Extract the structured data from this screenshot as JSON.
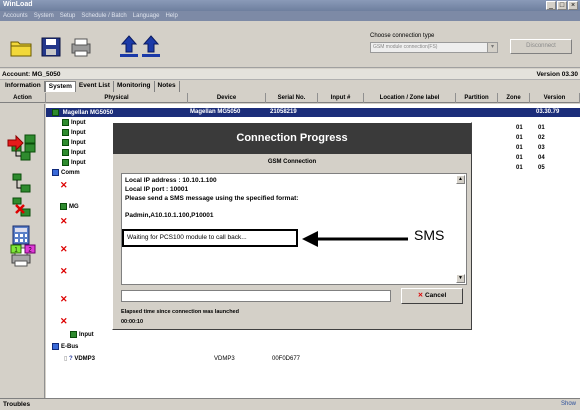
{
  "window": {
    "title": "WinLoad",
    "controls": [
      "_",
      "□",
      "×"
    ]
  },
  "menu": [
    "Accounts",
    "System",
    "Setup",
    "Schedule / Batch",
    "Language",
    "Help"
  ],
  "toolbar": {
    "connection_type_label": "Choose connection type",
    "connection_type_value": "GSM module connection(FS)",
    "disconnect_label": "Disconnect"
  },
  "account": {
    "label": "Account: MG_5050",
    "version": "Version 03.30"
  },
  "tabs": [
    "Information",
    "System",
    "Event List",
    "Monitoring",
    "Notes"
  ],
  "columns": [
    "Action",
    "Physical",
    "Device",
    "Serial No.",
    "Input #",
    "Location / Zone label",
    "Partition",
    "Zone",
    "Version"
  ],
  "tree": {
    "root": "Magellan MG5050",
    "device": "Magellan MG5050",
    "serial": "21058219",
    "version": "03.30.79",
    "inputs": [
      "Input",
      "Input",
      "Input",
      "Input",
      "Input"
    ],
    "zones": [
      "01",
      "02",
      "03",
      "04",
      "05"
    ],
    "partitions": [
      "01",
      "01",
      "01",
      "01",
      "01"
    ],
    "comm": "Comm",
    "mg": "MG",
    "ebus": "E-Bus",
    "vdmp": "VDMP3",
    "vdmp_device": "VDMP3",
    "vdmp_serial": "00F0D677",
    "last_input": "Input"
  },
  "dialog": {
    "title": "Connection Progress",
    "subtitle": "GSM Connection",
    "lines": [
      "Local IP address : 10.10.1.100",
      "Local IP port : 10001",
      "Please send a SMS message using the specified format:",
      "Padmin,A10.10.1.100,P10001"
    ],
    "waiting": "Waiting for PCS100 module to call back...",
    "cancel_label": "Cancel",
    "elapsed_label": "Elapsed time since connection was launched",
    "elapsed_value": "00:00:10"
  },
  "annotation": {
    "label": "SMS"
  },
  "statusbar": {
    "left": "Troubles",
    "right": "Show"
  },
  "colors": {
    "selection": "#1b2d7a",
    "dialog_title": "#3a3a3a",
    "input_icon": "#2e8b2e",
    "error_x": "#dd0000"
  }
}
